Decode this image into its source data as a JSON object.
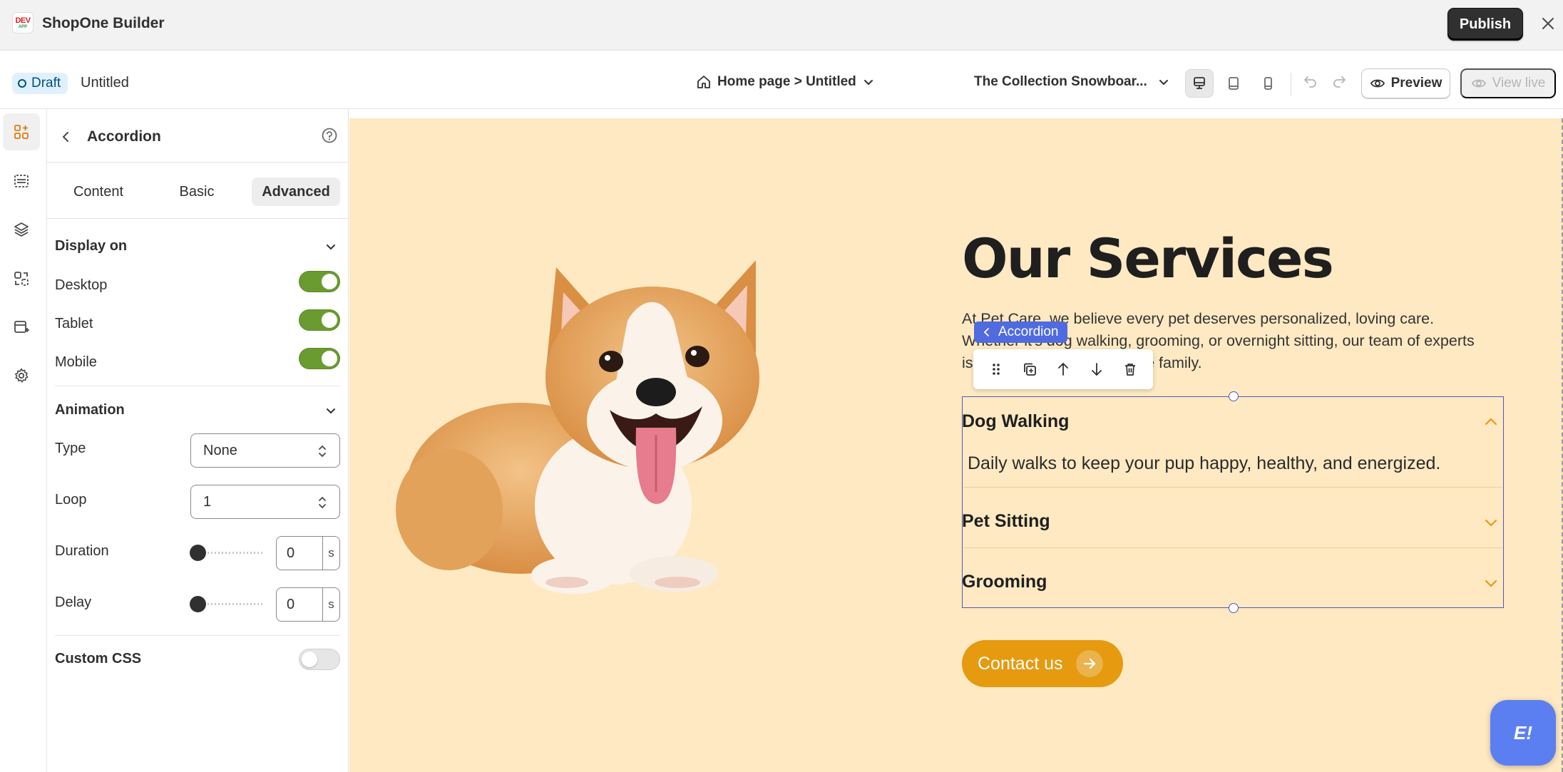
{
  "app": {
    "logo_top": "DEV",
    "logo_bottom": "APP",
    "title": "ShopOne Builder",
    "publish_label": "Publish"
  },
  "subbar": {
    "status": "Draft",
    "page_name": "Untitled",
    "breadcrumb": "Home page > Untitled",
    "product_selector": "The Collection Snowboar...",
    "preview_label": "Preview",
    "view_live_label": "View live"
  },
  "panel": {
    "title": "Accordion",
    "tabs": [
      "Content",
      "Basic",
      "Advanced"
    ],
    "active_tab": "Advanced",
    "display_on": {
      "heading": "Display on",
      "desktop": {
        "label": "Desktop",
        "on": true
      },
      "tablet": {
        "label": "Tablet",
        "on": true
      },
      "mobile": {
        "label": "Mobile",
        "on": true
      }
    },
    "animation": {
      "heading": "Animation",
      "type_label": "Type",
      "type_value": "None",
      "loop_label": "Loop",
      "loop_value": "1",
      "duration_label": "Duration",
      "duration_value": "0",
      "duration_unit": "s",
      "delay_label": "Delay",
      "delay_value": "0",
      "delay_unit": "s"
    },
    "custom_css": {
      "label": "Custom CSS",
      "on": false
    }
  },
  "canvas": {
    "heading": "Our Services",
    "description": "At Pet Care, we believe every pet deserves personalized, loving care. Whether it's dog walking, grooming, or overnight sitting, our team of experts is here to treat your pets like family.",
    "selected_badge": "Accordion",
    "accordion": [
      {
        "title": "Dog Walking",
        "body": "Daily walks to keep your pup happy, healthy, and energized.",
        "open": true
      },
      {
        "title": "Pet Sitting",
        "open": false
      },
      {
        "title": "Grooming",
        "open": false
      }
    ],
    "cta_label": "Contact us",
    "chat_label": "E!"
  },
  "colors": {
    "accent": "#e59a10",
    "canvas_bg": "#ffe9c2",
    "toggle_on": "#6a9b30",
    "selection": "#4f59b8"
  }
}
